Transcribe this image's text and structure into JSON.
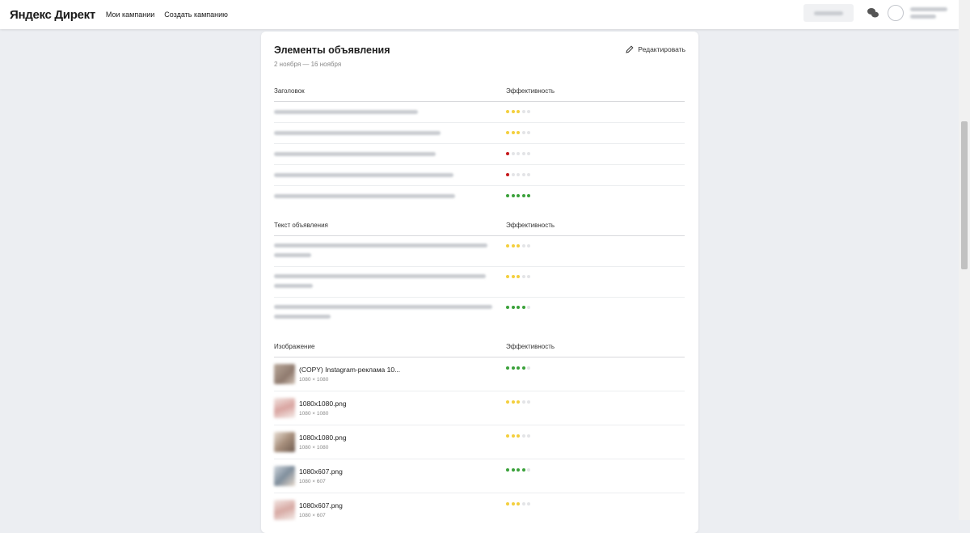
{
  "header": {
    "logo": "Яндекс Директ",
    "nav": [
      "Мои кампании",
      "Создать кампанию"
    ],
    "icons": {
      "chat": "chat-bubbles-icon",
      "user": "user-avatar-icon"
    }
  },
  "card": {
    "title": "Элементы объявления",
    "date_range": "2 ноября — 16 ноября",
    "edit_label": "Редактировать",
    "sections": [
      {
        "label": "Заголовок",
        "eff_label": "Эффективность",
        "rows": [
          {
            "rating": 3,
            "level": "medium"
          },
          {
            "rating": 3,
            "level": "medium"
          },
          {
            "rating": 1,
            "level": "low"
          },
          {
            "rating": 1,
            "level": "low"
          },
          {
            "rating": 5,
            "level": "high"
          }
        ]
      },
      {
        "label": "Текст объявления",
        "eff_label": "Эффективность",
        "rows": [
          {
            "rating": 3,
            "level": "medium"
          },
          {
            "rating": 3,
            "level": "medium"
          },
          {
            "rating": 4,
            "level": "high"
          }
        ]
      },
      {
        "label": "Изображение",
        "eff_label": "Эффективность",
        "rows": [
          {
            "name": "(COPY) Instagram-реклама 10...",
            "size": "1080 × 1080",
            "rating": 4,
            "level": "high"
          },
          {
            "name": "1080x1080.png",
            "size": "1080 × 1080",
            "rating": 3,
            "level": "medium"
          },
          {
            "name": "1080x1080.png",
            "size": "1080 × 1080",
            "rating": 3,
            "level": "medium"
          },
          {
            "name": "1080x607.png",
            "size": "1080 × 607",
            "rating": 4,
            "level": "high"
          },
          {
            "name": "1080x607.png",
            "size": "1080 × 607",
            "rating": 3,
            "level": "medium"
          }
        ]
      }
    ]
  },
  "colors": {
    "rating_high": "#3aa13a",
    "rating_medium": "#f4cf3d",
    "rating_low": "#c5171a",
    "rating_empty": "#e3e4e7",
    "page_bg": "#eceef2"
  }
}
